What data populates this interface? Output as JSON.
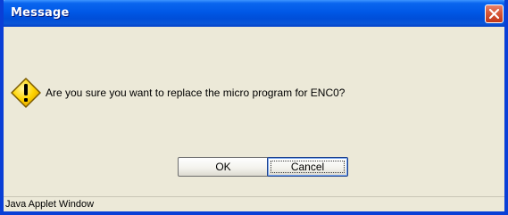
{
  "window": {
    "title": "Message",
    "close_icon": "close-icon",
    "accent": "#0a3fd6"
  },
  "dialog": {
    "icon": "warning-icon",
    "message": "Are you sure you want to replace the micro program for ENC0?"
  },
  "buttons": {
    "ok_label": "OK",
    "cancel_label": "Cancel"
  },
  "status": {
    "text": "Java Applet Window"
  }
}
